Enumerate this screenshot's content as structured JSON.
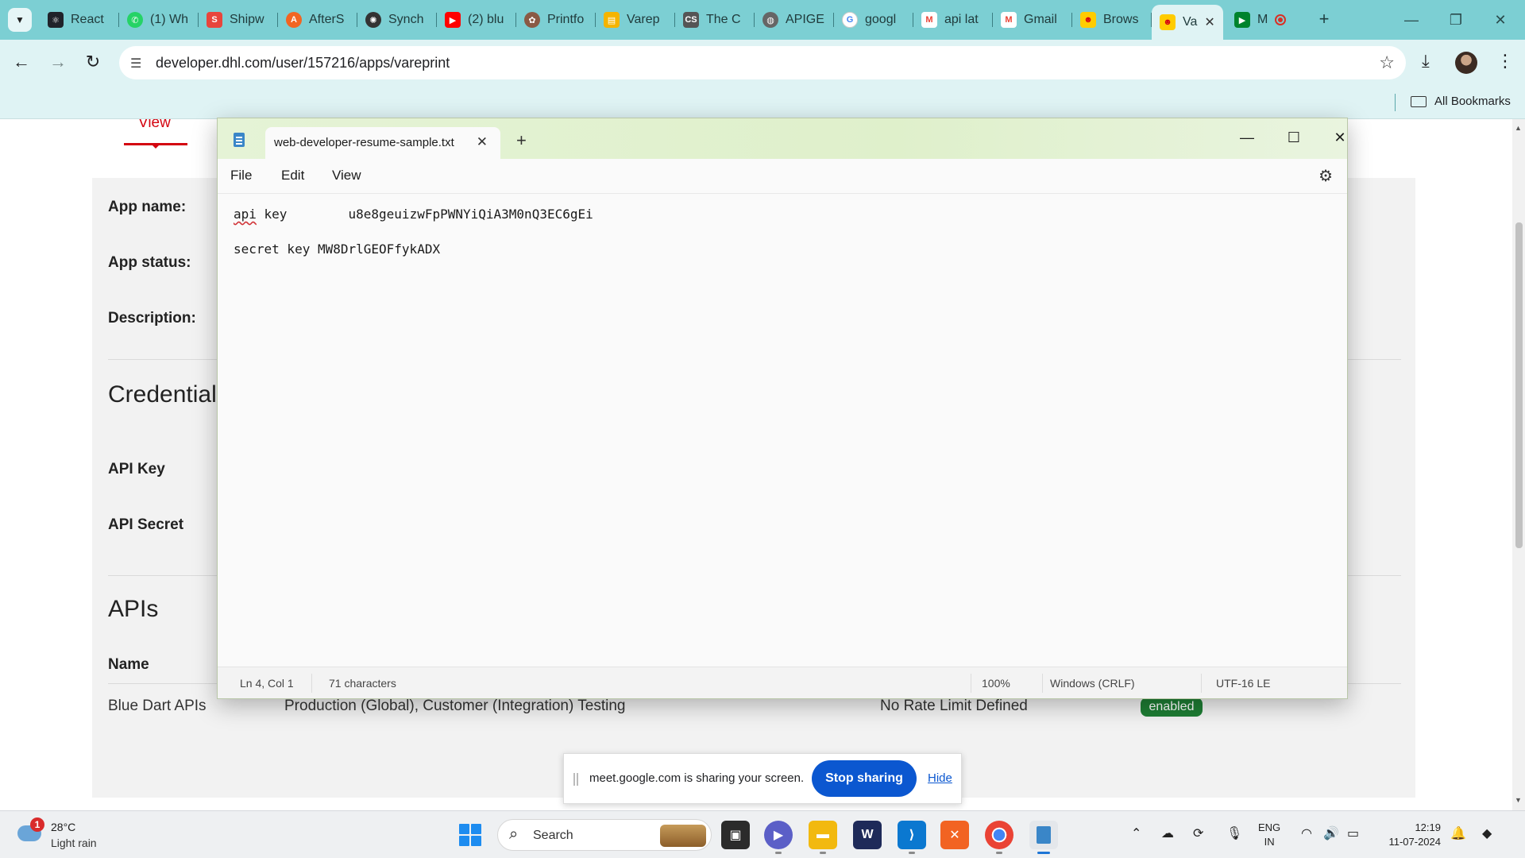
{
  "browser": {
    "tabs": [
      {
        "title": "React",
        "icon": "react-icon",
        "color": "#20232a"
      },
      {
        "title": "(1) Wh",
        "icon": "whatsapp-icon",
        "color": "#25d366"
      },
      {
        "title": "Shipw",
        "icon": "shipway-icon",
        "color": "#e8453c"
      },
      {
        "title": "AfterS",
        "icon": "aftership-icon",
        "color": "#f26522"
      },
      {
        "title": "Synch",
        "icon": "openai-icon",
        "color": "#333333"
      },
      {
        "title": "(2) blu",
        "icon": "youtube-icon",
        "color": "#ff0000"
      },
      {
        "title": "Printfo",
        "icon": "printful-icon",
        "color": "#8a5a44"
      },
      {
        "title": "Varep",
        "icon": "doc-icon",
        "color": "#f4b400"
      },
      {
        "title": "The C",
        "icon": "cs-icon",
        "color": "#555555"
      },
      {
        "title": "APIGE",
        "icon": "globe-icon",
        "color": "#666666"
      },
      {
        "title": "googl",
        "icon": "google-icon",
        "color": "#4285f4"
      },
      {
        "title": "api lat",
        "icon": "gmail-icon",
        "color": "#ea4335"
      },
      {
        "title": "Gmail",
        "icon": "gmail-icon",
        "color": "#ea4335"
      },
      {
        "title": "Brows",
        "icon": "dhl-icon",
        "color": "#ffcc00"
      },
      {
        "title": "Va",
        "icon": "dhl-icon",
        "color": "#ffcc00",
        "active": true
      },
      {
        "title": "M",
        "icon": "meet-icon",
        "color": "#00832d"
      }
    ],
    "url": "developer.dhl.com/user/157216/apps/vareprint",
    "bookmarks_label": "All Bookmarks"
  },
  "page": {
    "view_tab": "View",
    "labels": {
      "app_name": "App name:",
      "app_status": "App status:",
      "description": "Description:",
      "credentials": "Credential",
      "api_key": "API Key",
      "api_secret": "API Secret",
      "apis": "APIs",
      "name": "Name"
    },
    "api_row": {
      "name": "Blue Dart APIs",
      "environments": "Production (Global), Customer (Integration) Testing",
      "rate_limit": "No Rate Limit Defined",
      "status": "enabled"
    }
  },
  "notepad": {
    "tab_title": "web-developer-resume-sample.txt",
    "menu": [
      "File",
      "Edit",
      "View"
    ],
    "lines": {
      "line1_word1": "api",
      "line1_rest": " key        u8e8geuizwFpPWNYiQiA3M0nQ3EC6gEi",
      "line2": "secret key MW8DrlGEOFfykADX"
    },
    "status": {
      "position": "Ln 4, Col 1",
      "chars": "71 characters",
      "zoom": "100%",
      "line_ending": "Windows (CRLF)",
      "encoding": "UTF-16 LE"
    }
  },
  "sharing": {
    "message": "meet.google.com is sharing your screen.",
    "stop": "Stop sharing",
    "hide": "Hide"
  },
  "taskbar": {
    "weather_badge": "1",
    "temperature": "28°C",
    "condition": "Light rain",
    "search": "Search",
    "lang_line1": "ENG",
    "lang_line2": "IN",
    "time": "12:19",
    "date": "11-07-2024"
  }
}
